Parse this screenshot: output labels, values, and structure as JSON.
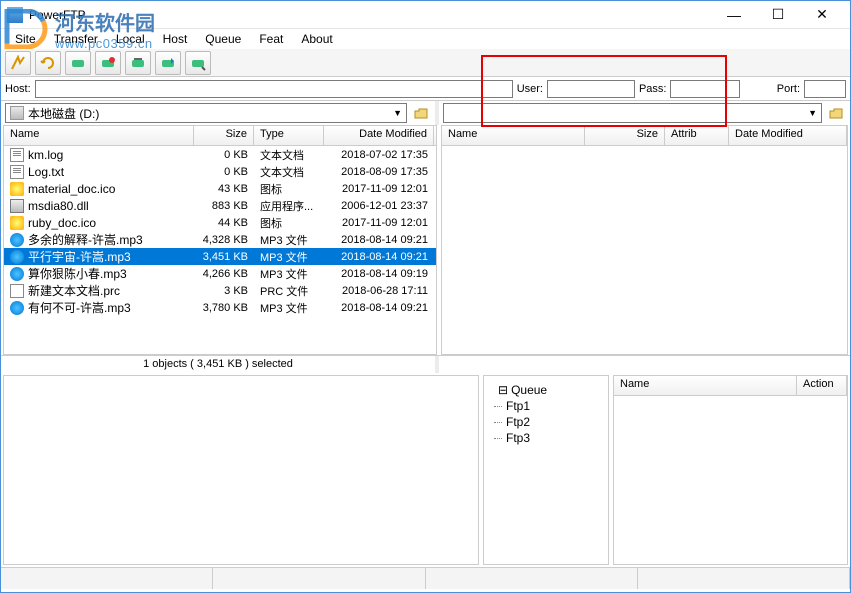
{
  "window": {
    "title": "PowerFTP"
  },
  "menu": [
    "Site",
    "Transfer",
    "Local",
    "Host",
    "Queue",
    "Feat",
    "About"
  ],
  "watermark": {
    "line1": "河东软件园",
    "line2": "www.pc0359.cn"
  },
  "connect": {
    "host_label": "Host:",
    "host": "",
    "user_label": "User:",
    "user": "",
    "pass_label": "Pass:",
    "pass": "",
    "port_label": "Port:",
    "port": ""
  },
  "local": {
    "path": "本地磁盘 (D:)",
    "columns": {
      "name": "Name",
      "size": "Size",
      "type": "Type",
      "date": "Date Modified"
    },
    "files": [
      {
        "name": "km.log",
        "size": "0 KB",
        "type": "文本文档",
        "date": "2018-07-02 17:35",
        "icon": "txt"
      },
      {
        "name": "Log.txt",
        "size": "0 KB",
        "type": "文本文档",
        "date": "2018-08-09 17:35",
        "icon": "txt"
      },
      {
        "name": "material_doc.ico",
        "size": "43 KB",
        "type": "图标",
        "date": "2017-11-09 12:01",
        "icon": "ico"
      },
      {
        "name": "msdia80.dll",
        "size": "883 KB",
        "type": "应用程序...",
        "date": "2006-12-01 23:37",
        "icon": "dll"
      },
      {
        "name": "ruby_doc.ico",
        "size": "44 KB",
        "type": "图标",
        "date": "2017-11-09 12:01",
        "icon": "ico"
      },
      {
        "name": "多余的解释-许嵩.mp3",
        "size": "4,328 KB",
        "type": "MP3 文件",
        "date": "2018-08-14 09:21",
        "icon": "mp3"
      },
      {
        "name": "平行宇宙-许嵩.mp3",
        "size": "3,451 KB",
        "type": "MP3 文件",
        "date": "2018-08-14 09:21",
        "icon": "mp3",
        "selected": true
      },
      {
        "name": "算你狠陈小春.mp3",
        "size": "4,266 KB",
        "type": "MP3 文件",
        "date": "2018-08-14 09:19",
        "icon": "mp3"
      },
      {
        "name": "新建文本文档.prc",
        "size": "3 KB",
        "type": "PRC 文件",
        "date": "2018-06-28 17:11",
        "icon": "prc"
      },
      {
        "name": "有何不可-许嵩.mp3",
        "size": "3,780 KB",
        "type": "MP3 文件",
        "date": "2018-08-14 09:21",
        "icon": "mp3"
      }
    ],
    "status": "1 objects ( 3,451 KB ) selected"
  },
  "remote": {
    "path": "",
    "columns": {
      "name": "Name",
      "size": "Size",
      "attrib": "Attrib",
      "date": "Date Modified"
    }
  },
  "queue": {
    "tree": {
      "root": "Queue",
      "children": [
        "Ftp1",
        "Ftp2",
        "Ftp3"
      ]
    },
    "columns": {
      "name": "Name",
      "action": "Action"
    }
  }
}
